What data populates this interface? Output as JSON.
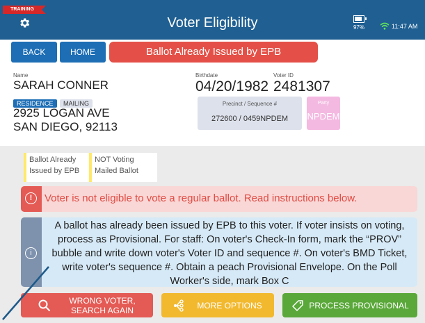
{
  "header": {
    "training_label": "TRAINING",
    "title": "Voter Eligibility",
    "battery_percent": "97%",
    "time": "11:47 AM"
  },
  "toolbar": {
    "back_label": "BACK",
    "home_label": "HOME",
    "status_label": "Ballot Already Issued by EPB"
  },
  "voter": {
    "name_label": "Name",
    "name": "SARAH CONNER",
    "address_tabs": [
      "RESIDENCE",
      "MAILING"
    ],
    "address_line1": "2925 LOGAN AVE",
    "address_line2": "SAN DIEGO, 92113",
    "birthdate_label": "Birthdate",
    "birthdate": "04/20/1982",
    "voter_id_label": "Voter ID",
    "voter_id": "2481307",
    "precinct_label": "Precinct / Sequence #",
    "precinct_value": "272600 / 0459NPDEM",
    "party_label": "Party",
    "party_value": "NPDEM"
  },
  "chips": [
    {
      "line1": "Ballot Already",
      "line2": "Issued by EPB"
    },
    {
      "line1": "NOT Voting",
      "line2": "Mailed Ballot"
    }
  ],
  "alerts": {
    "error_icon": "!",
    "error_text": "Voter is not eligible to vote a regular ballot.  Read instructions below.",
    "info_icon": "i",
    "info_text": "A ballot has already been issued by EPB to this voter. If voter insists on voting, process as Provisional. For staff: On voter's Check-In form, mark the “PROV” bubble and write down voter's Voter ID and sequence #. On voter's BMD Ticket, write voter's sequence #. Obtain a peach Provisional Envelope. On the Poll Worker's side, mark Box C"
  },
  "actions": {
    "wrong_voter_line1": "WRONG VOTER,",
    "wrong_voter_line2": "SEARCH AGAIN",
    "more_options": "MORE OPTIONS",
    "process_provisional": "PROCESS PROVISIONAL"
  },
  "colors": {
    "header_bg": "#1f5f92",
    "nav_button": "#1d6eb5",
    "status_red": "#e45047",
    "wrong_voter": "#e45a54",
    "more_options": "#f2b92f",
    "process_provisional": "#5aa83a"
  }
}
